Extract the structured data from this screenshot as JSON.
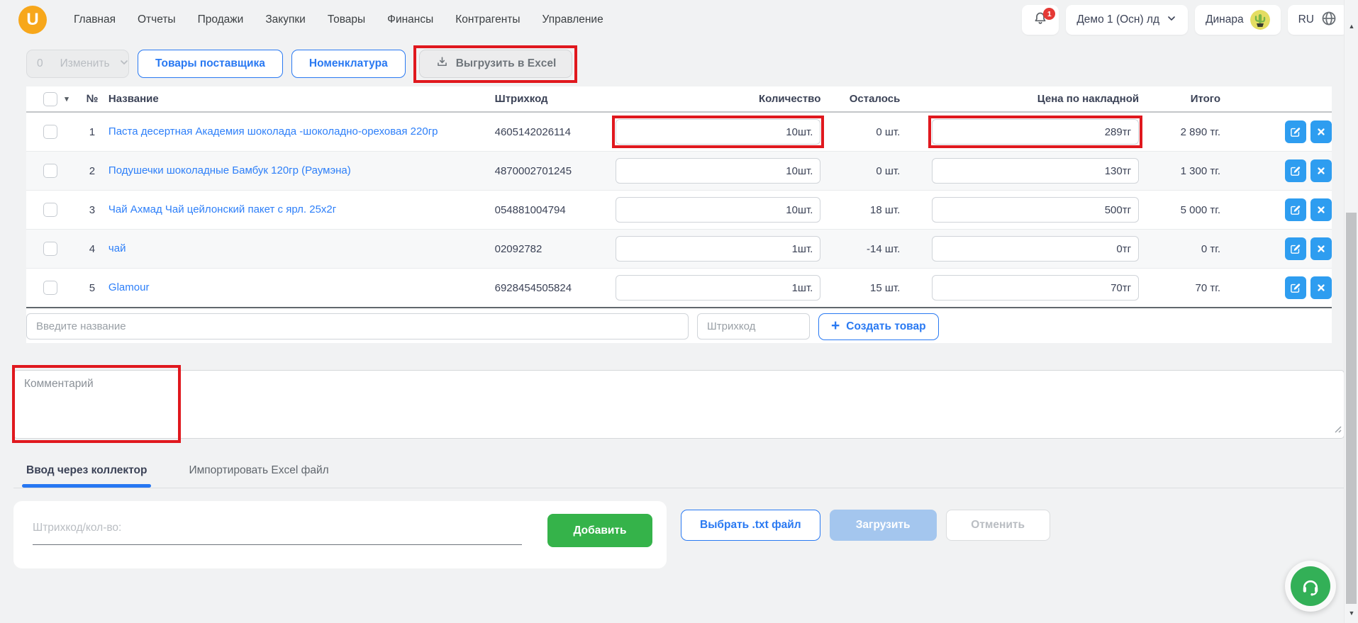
{
  "topbar": {
    "logo_letter": "U",
    "menu": [
      "Главная",
      "Отчеты",
      "Продажи",
      "Закупки",
      "Товары",
      "Финансы",
      "Контрагенты",
      "Управление"
    ],
    "notification_count": "1",
    "company_selector": "Демо 1 (Осн) лд",
    "user_name": "Динара",
    "language": "RU"
  },
  "toolbar": {
    "selected_count": "0",
    "change_label": "Изменить",
    "supplier_products_label": "Товары поставщика",
    "nomenclature_label": "Номенклатура",
    "export_excel_label": "Выгрузить в Excel"
  },
  "table": {
    "headers": {
      "num": "№",
      "name": "Название",
      "barcode": "Штрихкод",
      "quantity": "Количество",
      "remaining": "Осталось",
      "invoice_price": "Цена по накладной",
      "total": "Итого"
    },
    "rows": [
      {
        "num": "1",
        "name": "Паста десертная Академия шоколада -шоколадно-ореховая 220гр",
        "barcode": "4605142026114",
        "quantity": "10шт.",
        "remaining": "0 шт.",
        "price": "289тг",
        "total": "2 890 тг."
      },
      {
        "num": "2",
        "name": "Подушечки шоколадные Бамбук 120гр (Раумэна)",
        "barcode": "4870002701245",
        "quantity": "10шт.",
        "remaining": "0 шт.",
        "price": "130тг",
        "total": "1 300 тг."
      },
      {
        "num": "3",
        "name": "Чай Ахмад Чай цейлонский пакет с ярл. 25x2г",
        "barcode": "054881004794",
        "quantity": "10шт.",
        "remaining": "18 шт.",
        "price": "500тг",
        "total": "5 000 тг."
      },
      {
        "num": "4",
        "name": "чай",
        "barcode": "02092782",
        "quantity": "1шт.",
        "remaining": "-14 шт.",
        "price": "0тг",
        "total": "0 тг."
      },
      {
        "num": "5",
        "name": "Glamour",
        "barcode": "6928454505824",
        "quantity": "1шт.",
        "remaining": "15 шт.",
        "price": "70тг",
        "total": "70 тг."
      }
    ]
  },
  "add_row": {
    "name_placeholder": "Введите название",
    "barcode_placeholder": "Штрихкод",
    "create_label": "Создать товар"
  },
  "comment": {
    "placeholder": "Комментарий"
  },
  "tabs": [
    {
      "label": "Ввод через коллектор",
      "active": true
    },
    {
      "label": "Импортировать Excel файл",
      "active": false
    }
  ],
  "collector": {
    "input_placeholder": "Штрихкод/кол-во:",
    "add_label": "Добавить"
  },
  "import_controls": {
    "choose_file_label": "Выбрать .txt файл",
    "upload_label": "Загрузить",
    "cancel_label": "Отменить"
  },
  "icons": {
    "notification": "bell",
    "company_dropdown": "chevron-down",
    "language": "globe",
    "export": "download-tray",
    "select_all": "caret-down",
    "create": "plus",
    "edit": "pencil-square",
    "delete": "x-cross",
    "support": "headset"
  },
  "colors": {
    "accent_blue": "#2979f2",
    "icon_blue": "#2e9df0",
    "link_blue": "#2d7ff9",
    "highlight_red": "#e0181e",
    "success_green": "#35b34a",
    "upload_light_blue": "#a4c6ee",
    "badge_red": "#e53935",
    "logo_orange": "#f7a71b",
    "tab_underline": "#2677f2"
  }
}
